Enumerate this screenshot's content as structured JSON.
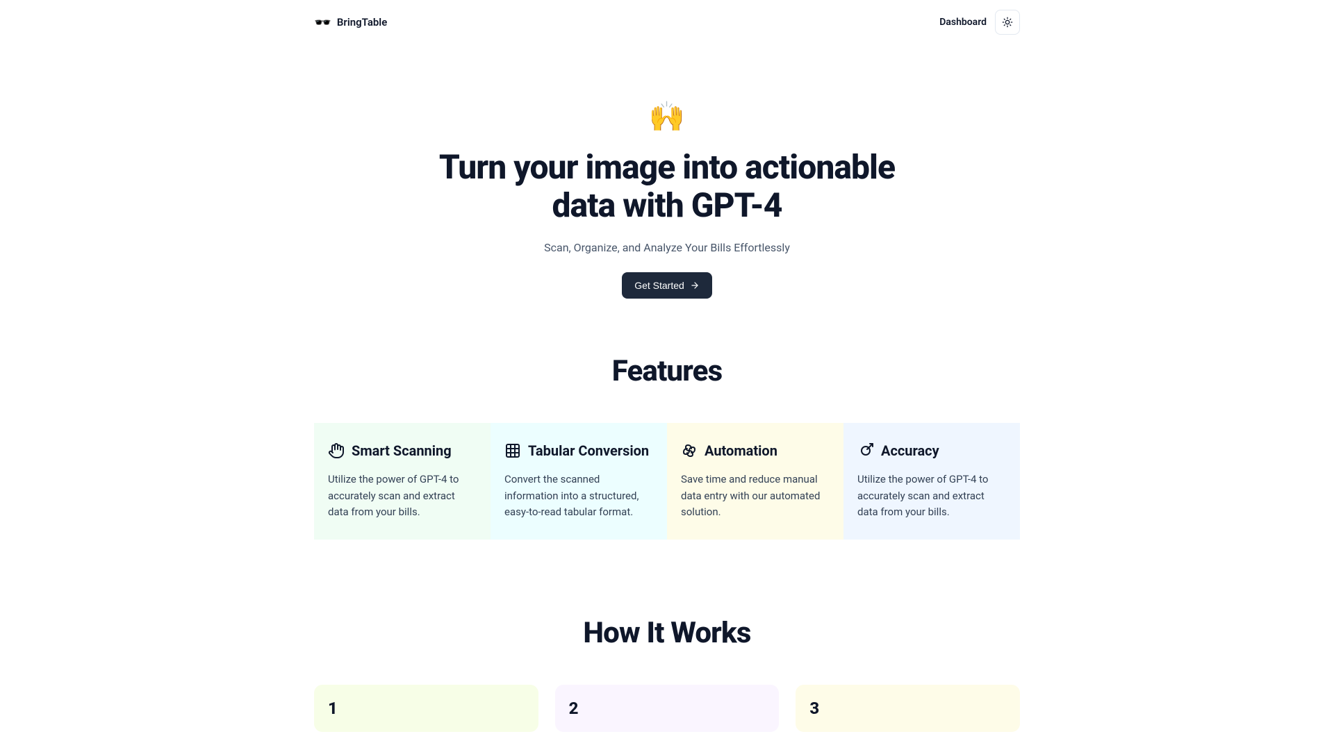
{
  "header": {
    "logo_text": "BringTable",
    "logo_emoji": "🕶️",
    "dashboard_label": "Dashboard"
  },
  "hero": {
    "emoji": "🙌",
    "title": "Turn your image into actionable data with GPT-4",
    "subtitle": "Scan, Organize, and Analyze Your Bills Effortlessly",
    "cta_label": "Get Started"
  },
  "features": {
    "heading": "Features",
    "items": [
      {
        "title": "Smart Scanning",
        "desc": "Utilize the power of GPT-4 to accurately scan and extract data from your bills."
      },
      {
        "title": "Tabular Conversion",
        "desc": "Convert the scanned information into a structured, easy-to-read tabular format."
      },
      {
        "title": "Automation",
        "desc": "Save time and reduce manual data entry with our automated solution."
      },
      {
        "title": "Accuracy",
        "desc": "Utilize the power of GPT-4 to accurately scan and extract data from your bills."
      }
    ]
  },
  "how_it_works": {
    "heading": "How It Works",
    "steps": [
      {
        "number": "1"
      },
      {
        "number": "2"
      },
      {
        "number": "3"
      }
    ]
  }
}
